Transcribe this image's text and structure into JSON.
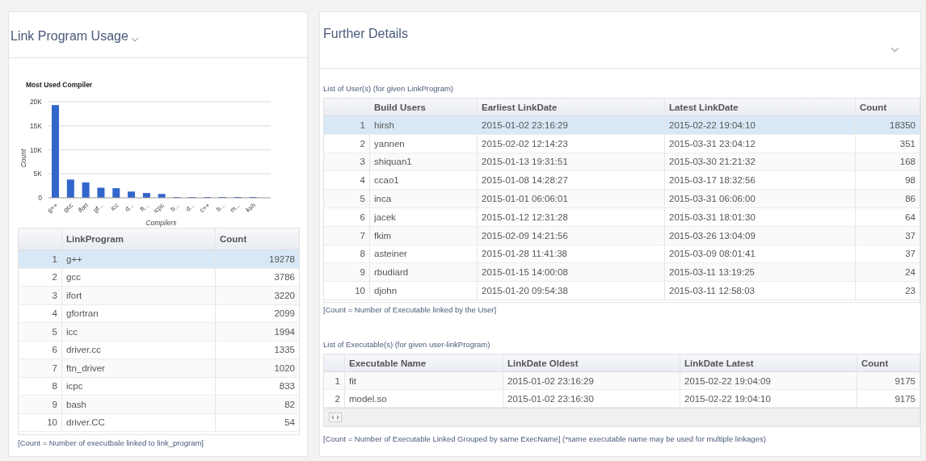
{
  "left_panel": {
    "title": "Link Program Usage",
    "chart": {
      "chart_data": {
        "type": "bar",
        "title": "Most Used Compiler",
        "xlabel": "Compilers",
        "ylabel": "Count",
        "categories": [
          "g++",
          "gcc",
          "ifort",
          "gf...",
          "icc",
          "d...",
          "ft...",
          "icpc",
          "b...",
          "d...",
          "c++",
          "b...",
          "m...",
          "ksh"
        ],
        "values": [
          19300,
          3800,
          3200,
          2100,
          2000,
          1300,
          1000,
          800,
          0,
          0,
          0,
          0,
          0,
          0
        ],
        "ylim": [
          0,
          20000
        ],
        "grid": true,
        "yticks": [
          {
            "value": 0,
            "label": "0"
          },
          {
            "value": 5000,
            "label": "5K"
          },
          {
            "value": 10000,
            "label": "10K"
          },
          {
            "value": 15000,
            "label": "15K"
          },
          {
            "value": 20000,
            "label": "20K"
          }
        ]
      }
    },
    "table": {
      "columns": [
        "LinkProgram",
        "Count"
      ],
      "rows": [
        {
          "index": "1",
          "cells": [
            "g++",
            "19278"
          ],
          "selected": true
        },
        {
          "index": "2",
          "cells": [
            "gcc",
            "3786"
          ],
          "selected": false
        },
        {
          "index": "3",
          "cells": [
            "ifort",
            "3220"
          ],
          "selected": false
        },
        {
          "index": "4",
          "cells": [
            "gfortran",
            "2099"
          ],
          "selected": false
        },
        {
          "index": "5",
          "cells": [
            "icc",
            "1994"
          ],
          "selected": false
        },
        {
          "index": "6",
          "cells": [
            "driver.cc",
            "1335"
          ],
          "selected": false
        },
        {
          "index": "7",
          "cells": [
            "ftn_driver",
            "1020"
          ],
          "selected": false
        },
        {
          "index": "8",
          "cells": [
            "icpc",
            "833"
          ],
          "selected": false
        },
        {
          "index": "9",
          "cells": [
            "bash",
            "82"
          ],
          "selected": false
        },
        {
          "index": "10",
          "cells": [
            "driver.CC",
            "54"
          ],
          "selected": false
        }
      ]
    },
    "note": "[Count = Number of executbale linked to link_program]"
  },
  "right_panel": {
    "title": "Further Details",
    "users": {
      "caption": "List of User(s) (for given LinkProgram)",
      "columns": [
        "Build Users",
        "Earliest LinkDate",
        "Latest LinkDate",
        "Count"
      ],
      "rows": [
        {
          "index": "1",
          "cells": [
            "hirsh",
            "2015-01-02 23:16:29",
            "2015-02-22 19:04:10",
            "18350"
          ],
          "selected": true
        },
        {
          "index": "2",
          "cells": [
            "yannen",
            "2015-02-02 12:14:23",
            "2015-03-31 23:04:12",
            "351"
          ],
          "selected": false
        },
        {
          "index": "3",
          "cells": [
            "shiquan1",
            "2015-01-13 19:31:51",
            "2015-03-30 21:21:32",
            "168"
          ],
          "selected": false
        },
        {
          "index": "4",
          "cells": [
            "ccao1",
            "2015-01-08 14:28:27",
            "2015-03-17 18:32:56",
            "98"
          ],
          "selected": false
        },
        {
          "index": "5",
          "cells": [
            "inca",
            "2015-01-01 06:06:01",
            "2015-03-31 06:06:00",
            "86"
          ],
          "selected": false
        },
        {
          "index": "6",
          "cells": [
            "jacek",
            "2015-01-12 12:31:28",
            "2015-03-31 18:01:30",
            "64"
          ],
          "selected": false
        },
        {
          "index": "7",
          "cells": [
            "fkim",
            "2015-02-09 14:21:56",
            "2015-03-26 13:04:09",
            "37"
          ],
          "selected": false
        },
        {
          "index": "8",
          "cells": [
            "asteiner",
            "2015-01-28 11:41:38",
            "2015-03-09 08:01:41",
            "37"
          ],
          "selected": false
        },
        {
          "index": "9",
          "cells": [
            "rbudiard",
            "2015-01-15 14:00:08",
            "2015-03-11 13:19:25",
            "24"
          ],
          "selected": false
        },
        {
          "index": "10",
          "cells": [
            "djohn",
            "2015-01-20 09:54:38",
            "2015-03-11 12:58:03",
            "23"
          ],
          "selected": false
        }
      ],
      "note": "[Count = Number of Executable linked by the User]"
    },
    "executables": {
      "caption": "List of Executable(s) (for given user-linkProgram)",
      "columns": [
        "Executable Name",
        "LinkDate Oldest",
        "LinkDate Latest",
        "Count"
      ],
      "rows": [
        {
          "index": "1",
          "cells": [
            "fit",
            "2015-01-02 23:16:29",
            "2015-02-22 19:04:09",
            "9175"
          ],
          "selected": false
        },
        {
          "index": "2",
          "cells": [
            "model.so",
            "2015-01-02 23:16:30",
            "2015-02-22 19:04:10",
            "9175"
          ],
          "selected": false
        }
      ],
      "note": "[Count = Number of Executable Linked Grouped by same ExecName] (*same executable name may be used for multiple linkages)"
    }
  }
}
